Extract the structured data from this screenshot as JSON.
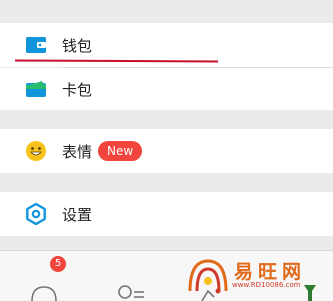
{
  "menu": {
    "wallet": {
      "label": "钱包",
      "icon": "wallet-icon"
    },
    "cards": {
      "label": "卡包",
      "icon": "card-pack-icon"
    },
    "stickers": {
      "label": "表情",
      "badge": "New",
      "icon": "emoji-icon"
    },
    "settings": {
      "label": "设置",
      "icon": "settings-icon"
    }
  },
  "tabbar": {
    "chats_unread": "5"
  },
  "watermark": {
    "name": "易旺网",
    "url": "www.RD10086.com"
  },
  "colors": {
    "accent_blue": "#1296db",
    "green": "#2bbd6e",
    "badge_red": "#f2453d",
    "underline_red": "#c8102e",
    "emoji_yellow": "#f7c21b",
    "watermark_orange": "#e06a1a"
  }
}
